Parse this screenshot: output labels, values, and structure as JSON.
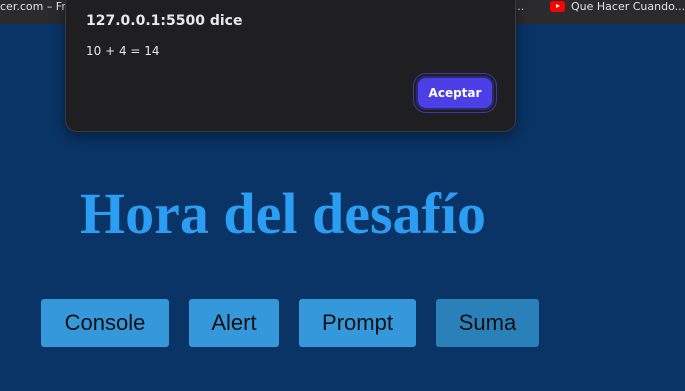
{
  "bookmarks": {
    "left_item": "cer.com – Fr...",
    "mid_item": ":...",
    "right_item": "Que Hacer Cuando..."
  },
  "dialog": {
    "title": "127.0.0.1:5500 dice",
    "message": "10 + 4 = 14",
    "ok_label": "Aceptar"
  },
  "page": {
    "title": "Hora del desafío",
    "buttons": [
      {
        "label": "Console"
      },
      {
        "label": "Alert"
      },
      {
        "label": "Prompt"
      },
      {
        "label": "Suma"
      }
    ]
  },
  "colors": {
    "page_background": "#0a3466",
    "title": "#2b9df2",
    "button": "#3498db",
    "button_hover": "#2a80b9",
    "dialog_accent": "#4c3fe8"
  },
  "icons": [
    "youtube-icon"
  ]
}
